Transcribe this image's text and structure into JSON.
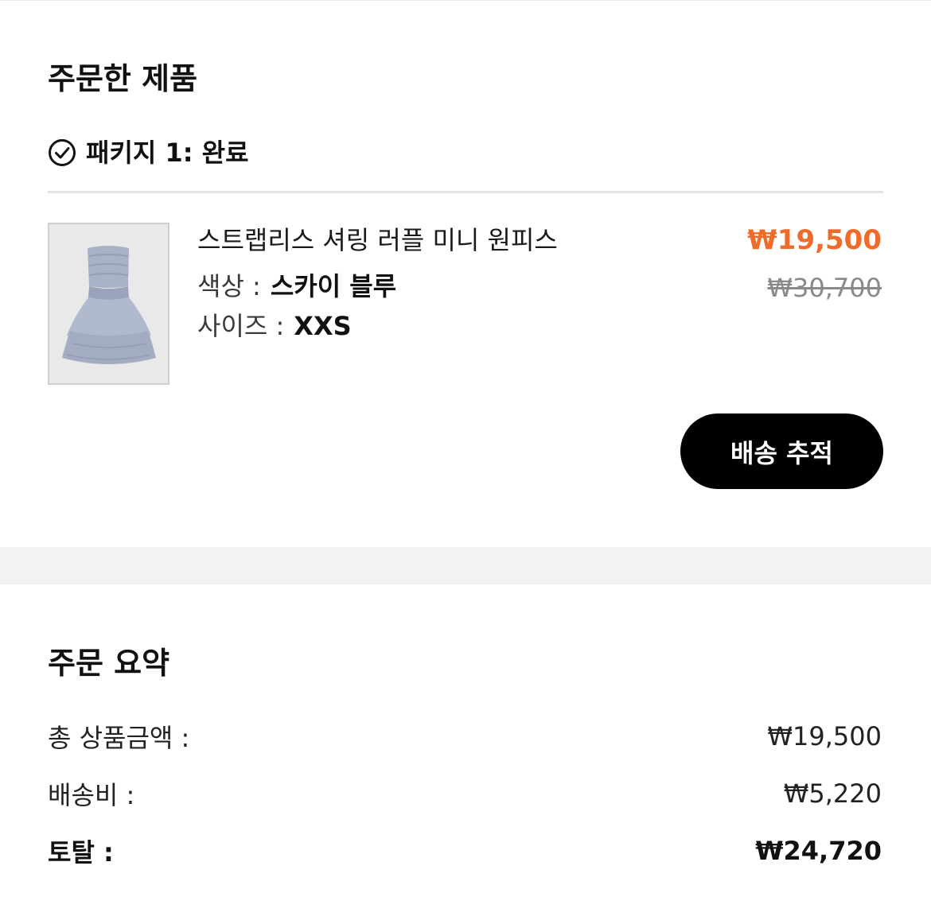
{
  "ordered_products": {
    "title": "주문한 제품",
    "package": {
      "label": "패키지 1: 완료",
      "icon": "check-circle-icon"
    },
    "item": {
      "name": "스트랩리스 셔링 러플 미니 원피스",
      "color_label": "색상 :",
      "color_value": "스카이 블루",
      "size_label": "사이즈 :",
      "size_value": "XXS",
      "price_sale": "₩19,500",
      "price_original": "₩30,700",
      "sale_color": "#f06a2a",
      "product_color": "#a9b1c6"
    },
    "track_button": "배송 추적"
  },
  "order_summary": {
    "title": "주문 요약",
    "rows": [
      {
        "label": "총 상품금액 :",
        "value": "₩19,500"
      },
      {
        "label": "배송비 :",
        "value": "₩5,220"
      },
      {
        "label": "토탈 :",
        "value": "₩24,720"
      }
    ]
  }
}
